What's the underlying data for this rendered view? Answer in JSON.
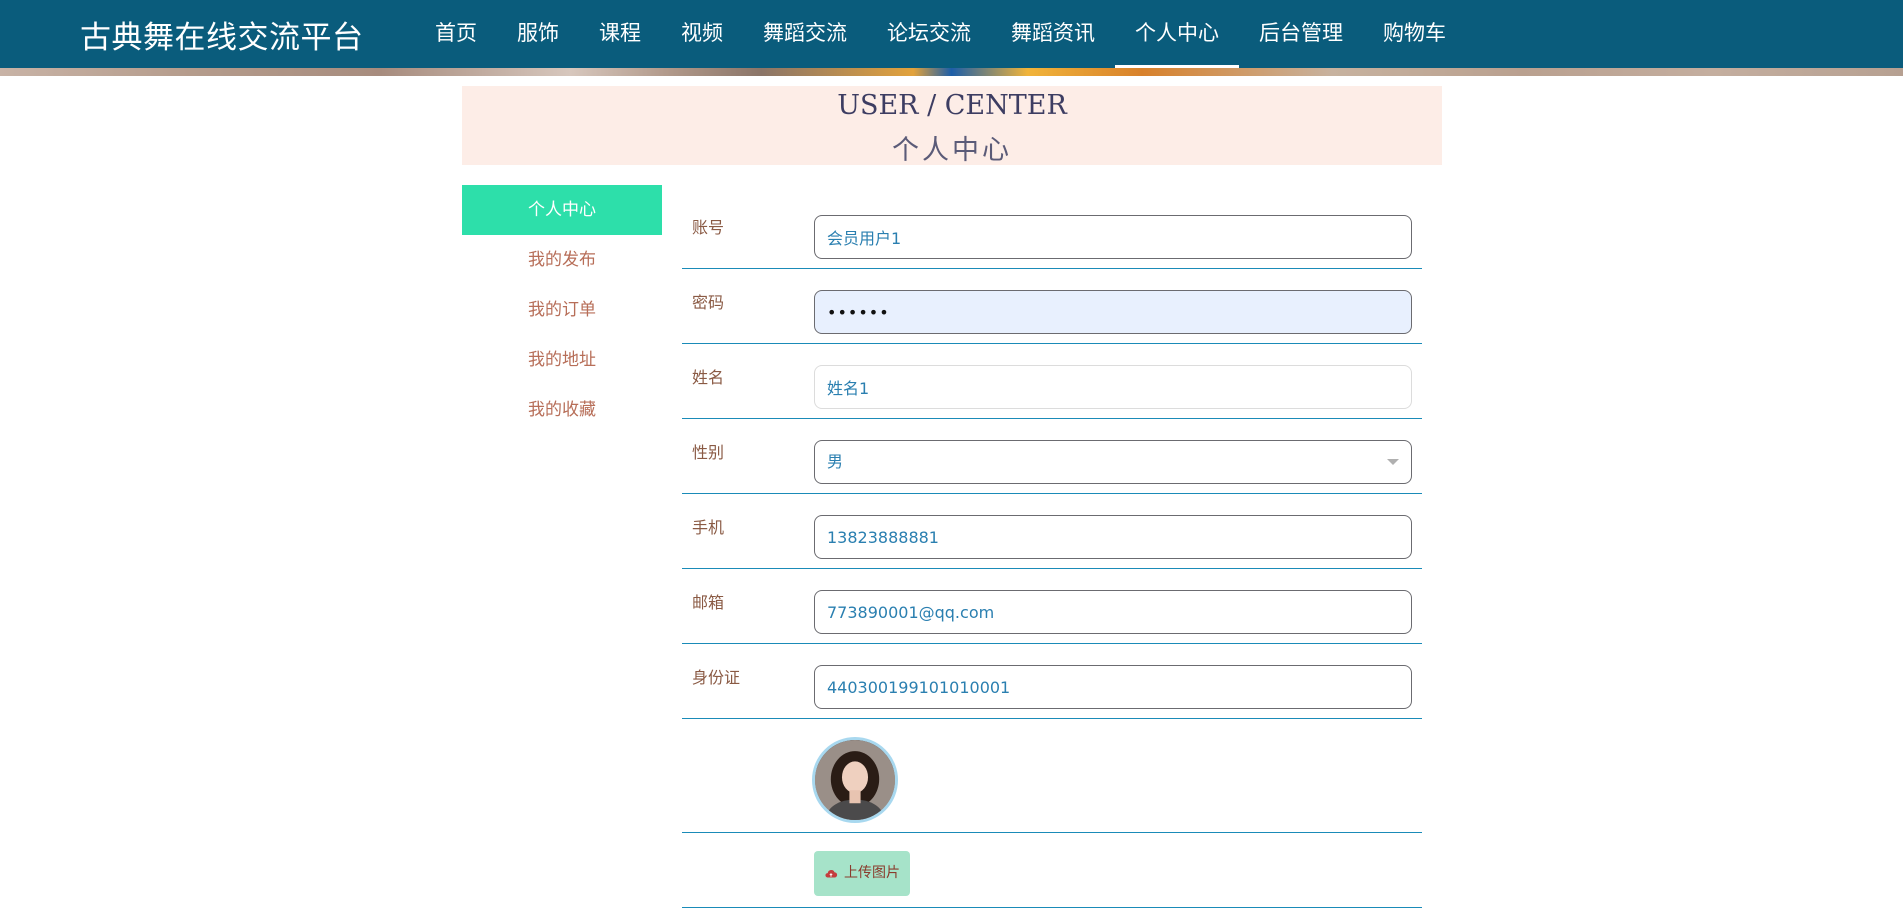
{
  "header": {
    "brand": "古典舞在线交流平台",
    "nav": [
      "首页",
      "服饰",
      "课程",
      "视频",
      "舞蹈交流",
      "论坛交流",
      "舞蹈资讯",
      "个人中心",
      "后台管理",
      "购物车"
    ],
    "active_nav": "个人中心"
  },
  "section": {
    "title_en": "USER / CENTER",
    "title_cn": "个人中心"
  },
  "sidebar": {
    "items": [
      "个人中心",
      "我的发布",
      "我的订单",
      "我的地址",
      "我的收藏"
    ],
    "active": "个人中心"
  },
  "form": {
    "account": {
      "label": "账号",
      "value": "会员用户1"
    },
    "password": {
      "label": "密码",
      "value": "123456"
    },
    "name": {
      "label": "姓名",
      "value": "姓名1"
    },
    "gender": {
      "label": "性别",
      "value": "男"
    },
    "phone": {
      "label": "手机",
      "value": "13823888881"
    },
    "email": {
      "label": "邮箱",
      "value": "773890001@qq.com"
    },
    "id_card": {
      "label": "身份证",
      "value": "440300199101010001"
    },
    "upload_label": "上传图片"
  },
  "icons": {
    "upload": "cloud-upload-icon",
    "select": "chevron-down-icon"
  },
  "colors": {
    "header_bg": "#0a5c7c",
    "active_menu": "#2ddfaa",
    "title_bg": "#fdede7",
    "divider": "#1a8bb8",
    "upload_btn": "#a6e3c9"
  }
}
